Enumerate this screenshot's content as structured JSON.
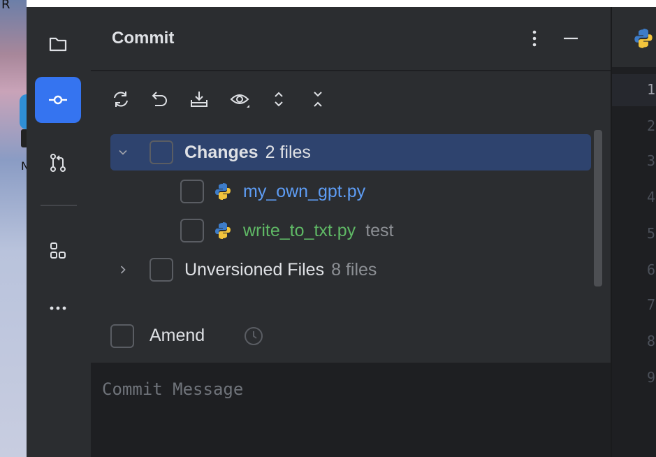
{
  "desktop": {
    "corner_text": "R",
    "side_text": "N"
  },
  "panel": {
    "title": "Commit"
  },
  "toolbar": {
    "items": [
      "refresh-icon",
      "rollback-icon",
      "shelve-icon",
      "preview-icon",
      "expand-all-icon",
      "collapse-all-icon"
    ]
  },
  "tree": {
    "changes": {
      "label": "Changes",
      "count": "2 files"
    },
    "files": [
      {
        "name": "my_own_gpt.py",
        "note": ""
      },
      {
        "name": "write_to_txt.py",
        "note": "test"
      }
    ],
    "unversioned": {
      "label": "Unversioned Files",
      "count": "8 files"
    }
  },
  "amend": {
    "label": "Amend"
  },
  "message": {
    "placeholder": "Commit Message"
  },
  "editor": {
    "line_numbers": [
      "1",
      "2",
      "3",
      "4",
      "5",
      "6",
      "7",
      "8",
      "9"
    ]
  },
  "colors": {
    "accent": "#3574f0",
    "selection": "#2e436e",
    "modified_file": "#5e9df5",
    "added_file": "#5fb865"
  }
}
